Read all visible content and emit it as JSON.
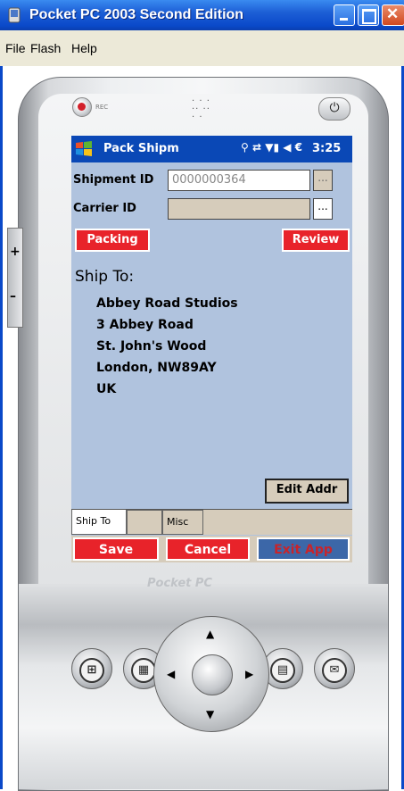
{
  "window": {
    "title": "Pocket PC 2003 Second Edition",
    "menu": [
      "File",
      "Flash",
      "Help"
    ]
  },
  "device": {
    "rec_label": "REC",
    "power_icon": "power-icon",
    "side_buttons": [
      "+",
      "–"
    ],
    "logo": "Pocket PC"
  },
  "statusbar": {
    "title": "Pack Shipm",
    "icons": [
      "connectivity-icon",
      "sync-arrows-icon",
      "signal-icon",
      "volume-icon"
    ],
    "time": "3:25"
  },
  "form": {
    "shipment_id_label": "Shipment ID",
    "shipment_id_value": "0000000364",
    "carrier_id_label": "Carrier ID",
    "carrier_id_value": "",
    "browse_label": "...",
    "packing_button": "Packing",
    "review_button": "Review",
    "ship_to_heading": "Ship To:",
    "address_lines": [
      "Abbey Road Studios",
      "3 Abbey Road",
      "St. John's Wood",
      "London, NW89AY",
      "UK"
    ],
    "edit_addr_button": "Edit Addr"
  },
  "tabs": [
    "Ship To",
    "",
    "Misc"
  ],
  "bottom_bar": {
    "save": "Save",
    "cancel": "Cancel",
    "exit": "Exit App"
  },
  "colors": {
    "screen_bg": "#b0c3de",
    "statusbar": "#0a48b6",
    "red_button": "#e8232a",
    "exit_button": "#3c67a8",
    "exit_text": "#c8242b",
    "panel": "#d6ccbb"
  }
}
